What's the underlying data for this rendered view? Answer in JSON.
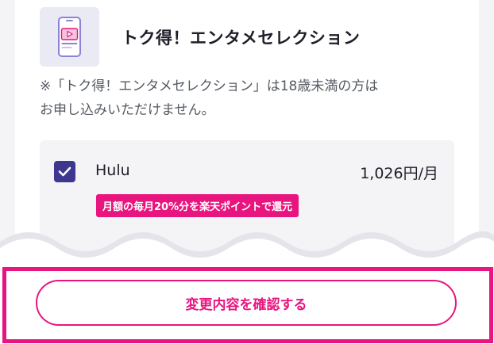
{
  "section": {
    "title": "トク得！エンタメセレクション",
    "icon": "tablet-video-icon",
    "notice_line1": "※「トク得！エンタメセレクション」は18歳未満の方は",
    "notice_line2": "お申し込みいただけません。"
  },
  "option": {
    "checked": true,
    "name": "Hulu",
    "price": "1,026円/月",
    "promo": "月額の毎月20%分を楽天ポイントで還元"
  },
  "footer": {
    "confirm_label": "変更内容を確認する"
  },
  "colors": {
    "accent": "#e8157f",
    "checkbox": "#3d3790",
    "icon_bg": "#eaeaf4",
    "icon_stroke": "#8a83d6"
  }
}
